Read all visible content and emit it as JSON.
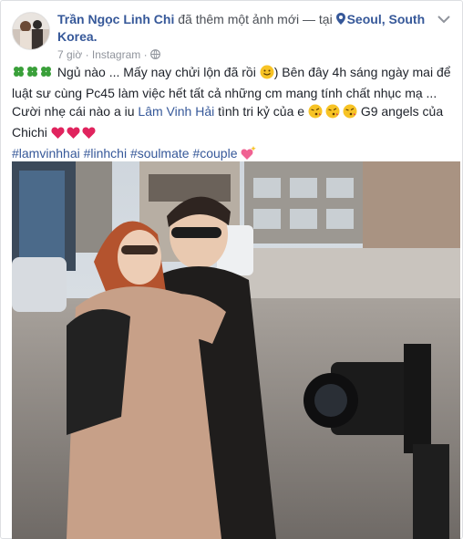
{
  "post": {
    "author": "Trần Ngọc Linh Chi",
    "action_text": " đã thêm một ảnh mới — tại ",
    "location": "Seoul, South Korea.",
    "time": "7 giờ",
    "separator": "·",
    "source": "Instagram",
    "separator2": "·",
    "icons": {
      "avatar": "profile-avatar",
      "location": "map-pin-icon",
      "audience": "globe-icon",
      "options": "chevron-down-icon"
    }
  },
  "body": {
    "line1_a": " Ngủ nào ... Mấy nay chửi lộn đã rồi ",
    "line1_b": ") Bên đây 4h sáng ngày mai để luật sư cùng Pc45 làm việc hết tất cả những cm mang tính chất nhục mạ ... Cười nhẹ cái nào a iu ",
    "mention": "Lâm Vinh Hải",
    "line1_c": " tình tri kỷ của e ",
    "line1_d": " G9 angels của Chichi ",
    "hashtags": "#lamvinhhai #linhchi #soulmate #couple",
    "emoji_names": [
      "clover-emoji",
      "smile-emoji",
      "kiss-emoji",
      "heart-emoji",
      "sparkling-heart-emoji"
    ]
  },
  "colors": {
    "link": "#365899",
    "meta": "#90949c",
    "text": "#1d2129",
    "heart": "#e0245e",
    "clover": "#3aa03a"
  }
}
